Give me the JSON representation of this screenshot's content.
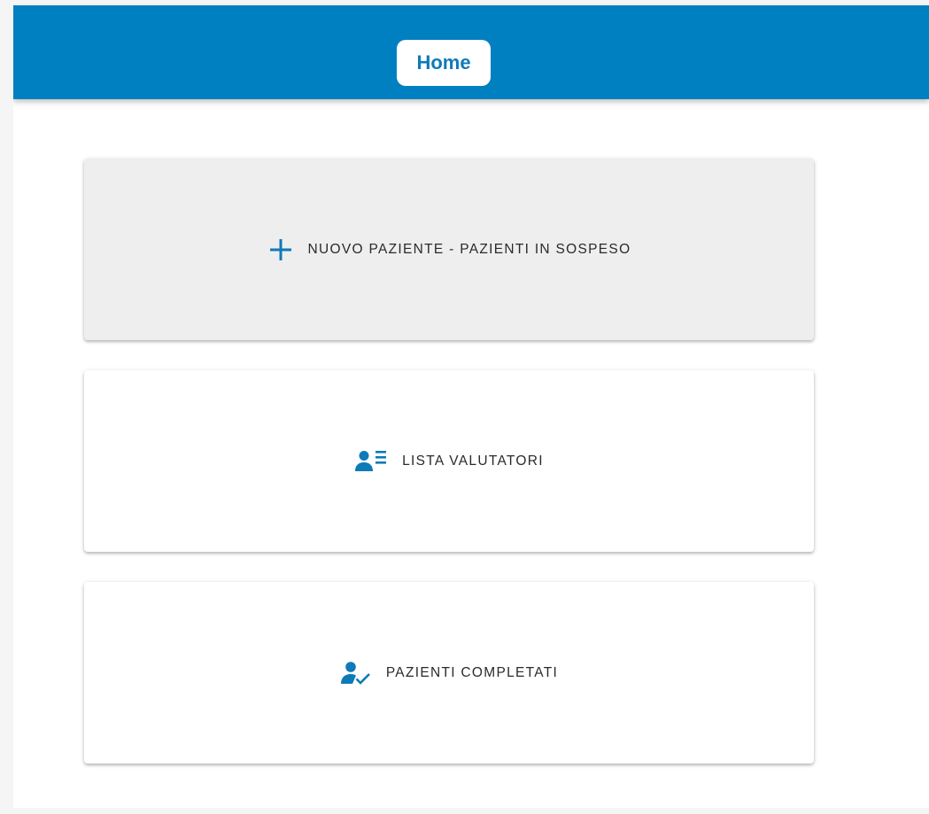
{
  "header": {
    "home_label": "Home"
  },
  "menu": {
    "items": [
      {
        "label": "NUOVO PAZIENTE - PAZIENTI IN SOSPESO",
        "icon": "plus-icon"
      },
      {
        "label": "LISTA VALUTATORI",
        "icon": "person-list-icon"
      },
      {
        "label": "PAZIENTI COMPLETATI",
        "icon": "person-check-icon"
      }
    ]
  },
  "colors": {
    "app_bar": "#0080c0",
    "accent": "#0f7ab8",
    "card_highlight": "#eeeeee",
    "card": "#ffffff"
  }
}
